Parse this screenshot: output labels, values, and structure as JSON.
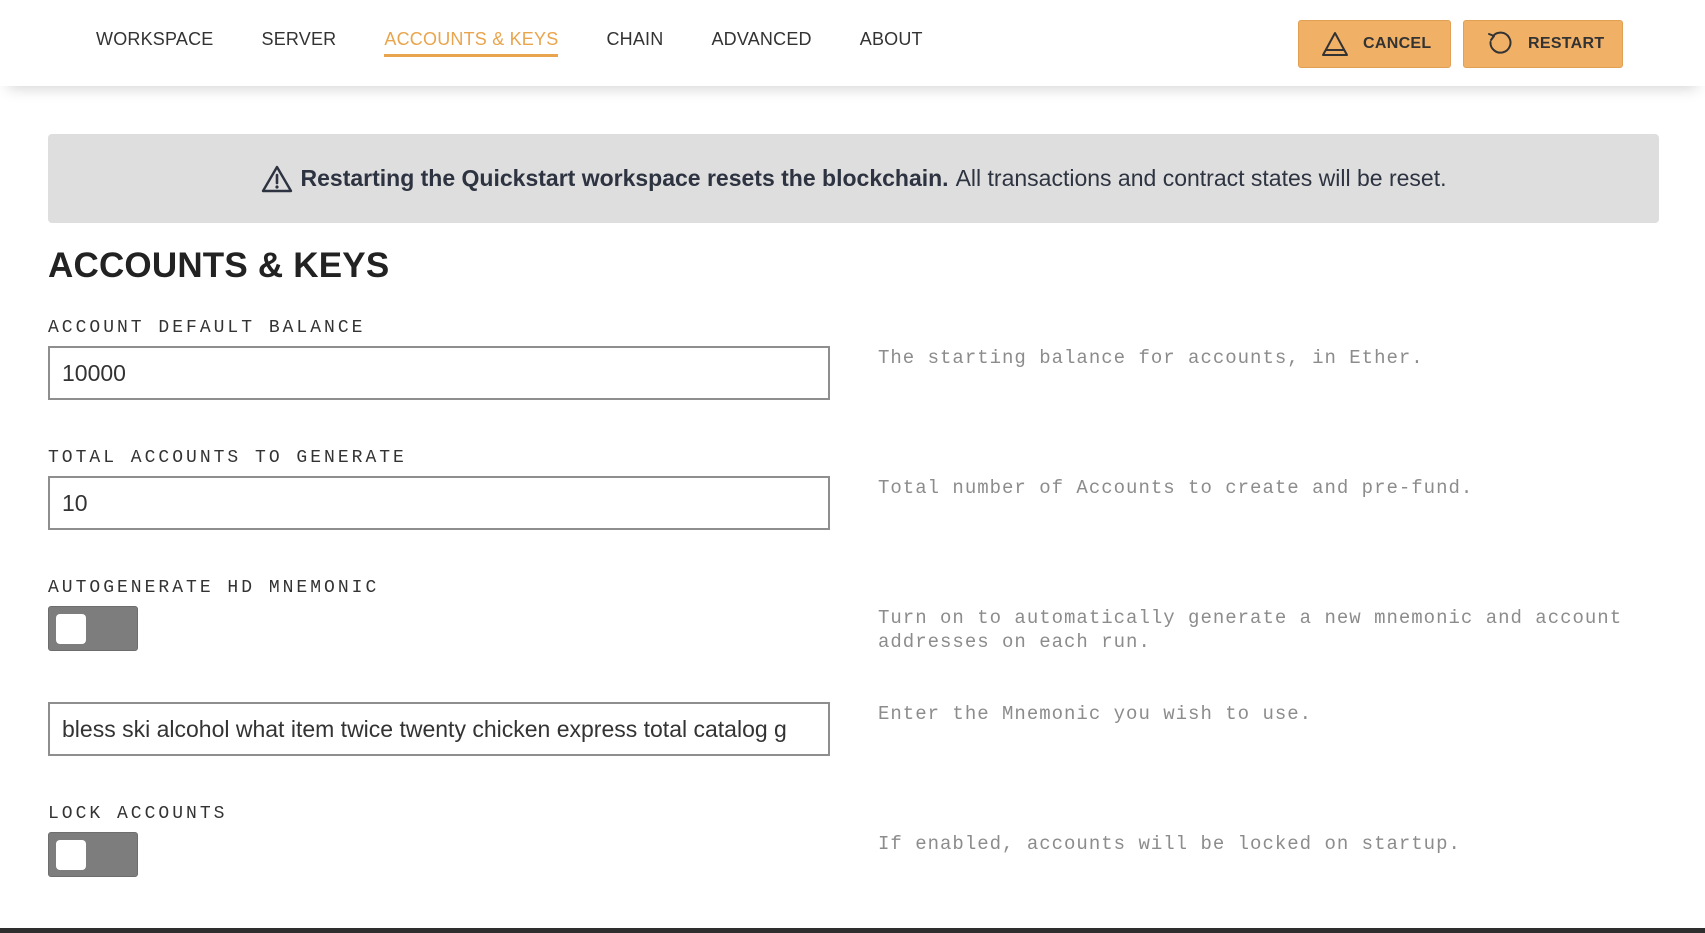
{
  "nav": {
    "tabs": [
      {
        "label": "WORKSPACE"
      },
      {
        "label": "SERVER"
      },
      {
        "label": "ACCOUNTS & KEYS"
      },
      {
        "label": "CHAIN"
      },
      {
        "label": "ADVANCED"
      },
      {
        "label": "ABOUT"
      }
    ],
    "active_tab": "ACCOUNTS & KEYS",
    "cancel_label": "CANCEL",
    "restart_label": "RESTART"
  },
  "banner": {
    "bold_text": "Restarting the Quickstart workspace resets the blockchain.",
    "text": "All transactions and contract states will be reset."
  },
  "section": {
    "title": "ACCOUNTS & KEYS",
    "fields": {
      "default_balance": {
        "label": "ACCOUNT DEFAULT BALANCE",
        "value": "10000",
        "help": "The starting balance for accounts, in Ether."
      },
      "total_accounts": {
        "label": "TOTAL ACCOUNTS TO GENERATE",
        "value": "10",
        "help": "Total number of Accounts to create and pre-fund."
      },
      "autogenerate_mnemonic": {
        "label": "AUTOGENERATE HD MNEMONIC",
        "enabled": false,
        "help": "Turn on to automatically generate a new mnemonic and account addresses on each run."
      },
      "mnemonic": {
        "value": "bless ski alcohol what item twice twenty chicken express total catalog g",
        "help": "Enter the Mnemonic you wish to use."
      },
      "lock_accounts": {
        "label": "LOCK ACCOUNTS",
        "enabled": false,
        "help": "If enabled, accounts will be locked on startup."
      }
    }
  },
  "colors": {
    "accent": "#e9a54d",
    "button": "#f0b066",
    "banner_bg": "#dedede",
    "toggle_off": "#7d7d7d",
    "help_text": "#8c8c8c"
  },
  "icons": {
    "cancel": "warning-triangle-icon",
    "restart": "restart-icon",
    "banner": "warning-triangle-icon"
  }
}
